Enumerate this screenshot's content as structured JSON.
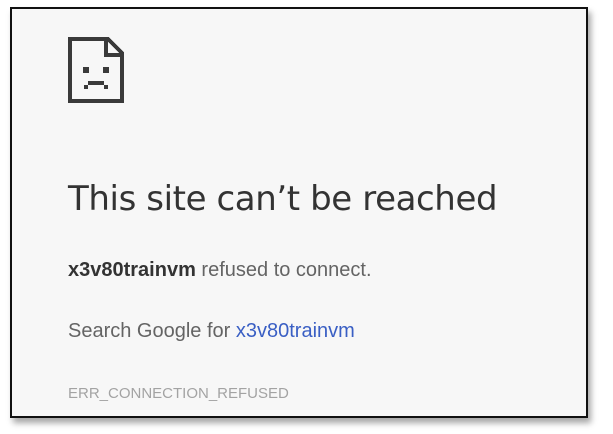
{
  "error_page": {
    "icon": "sad-page-icon",
    "title": "This site can’t be reached",
    "host": "x3v80trainvm",
    "refused_text": " refused to connect.",
    "search_prefix": "Search Google for ",
    "search_link": "x3v80trainvm",
    "error_code": "ERR_CONNECTION_REFUSED"
  },
  "colors": {
    "background": "#f7f7f7",
    "title": "#333333",
    "body_text": "#646464",
    "link": "#3a5fc4",
    "error_code": "#a3a3a3"
  }
}
